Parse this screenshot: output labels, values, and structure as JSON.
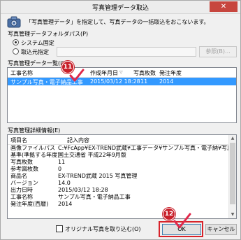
{
  "window": {
    "title": "写真管理データ取込",
    "close_glyph": "✕"
  },
  "intro_text": "「写真管理データ」を指定して、写真データの一括取込をおこないます。",
  "folder_path": {
    "label": "写真管理データフォルダパス(P)",
    "options": [
      {
        "label": "システム固定",
        "checked": true
      },
      {
        "label": "取込元指定",
        "checked": false
      }
    ],
    "value": "",
    "browse_label": "参照(B)..."
  },
  "list": {
    "label": "写真管理データ一覧(I)",
    "columns": [
      "工事名称",
      "作成年月日",
      "写真枚数",
      "発注年度"
    ],
    "rows": [
      {
        "name": "サンプル写真・電子納品工事",
        "date": "2015/03/12 18:28",
        "count": "11",
        "year": "2014",
        "selected": true
      }
    ]
  },
  "detail": {
    "label": "写真管理詳細情報(E)",
    "columns": [
      "項目名",
      "記入内容"
    ],
    "rows": [
      {
        "key": "画像ファイルパス",
        "value": "C:¥FcApp¥EX-TREND武蔵¥工事データ¥サンプル写真・電子納¥写真管理¥m"
      },
      {
        "key": "基準(準拠する年度)",
        "value": "国土交通省 平成22年9月版"
      },
      {
        "key": "写真枚数",
        "value": "11"
      },
      {
        "key": "参考図枚数",
        "value": "0"
      },
      {
        "key": "商品名",
        "value": "EX-TREND武蔵 2015 写真管理"
      },
      {
        "key": "バージョン",
        "value": "14.0"
      },
      {
        "key": "出力日時",
        "value": "2015/03/12 18:28"
      },
      {
        "key": "工事名称",
        "value": "サンプル写真・電子納品工事"
      },
      {
        "key": "発注年度(西暦)",
        "value": "2014"
      }
    ]
  },
  "original_photo_checkbox": {
    "label": "オリジナル写真を取り込む(O)",
    "checked": false
  },
  "buttons": {
    "ok": "OK",
    "cancel": "キャンセル"
  },
  "callouts": {
    "list_badge": "11",
    "ok_badge": "12"
  },
  "colors": {
    "selection": "#3399ff",
    "callout": "#c8202a",
    "check": "#e0284a"
  }
}
